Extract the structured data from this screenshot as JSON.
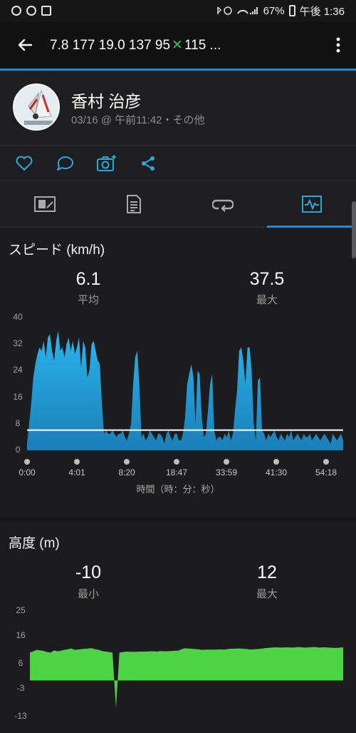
{
  "statusbar": {
    "battery": "67%",
    "time": "午後 1:36"
  },
  "appbar": {
    "title_pre": "7.8  177  19.0  137  95",
    "title_post": "115 ..."
  },
  "profile": {
    "name": "香村 治彦",
    "meta": "03/16 @ 午前11:42・その他"
  },
  "tabs": [
    {
      "icon": "overview-flag-icon"
    },
    {
      "icon": "details-document-icon"
    },
    {
      "icon": "laps-loop-icon"
    },
    {
      "icon": "charts-icon",
      "active": true
    }
  ],
  "speed": {
    "title": "スピード (km/h)",
    "avg_value": "6.1",
    "avg_label": "平均",
    "max_value": "37.5",
    "max_label": "最大",
    "xlabel": "時間（時：分：秒）"
  },
  "altitude": {
    "title": "高度 (m)",
    "min_value": "-10",
    "min_label": "最小",
    "max_value": "12",
    "max_label": "最大"
  },
  "chart_data": [
    {
      "type": "area",
      "title": "スピード (km/h)",
      "xlabel": "時間（時：分：秒）",
      "ylabel": "",
      "ylim": [
        0,
        40
      ],
      "yticks": [
        "40",
        "32",
        "24",
        "16",
        "8",
        "0"
      ],
      "xticks": [
        "0:00",
        "4:01",
        "8:20",
        "18:47",
        "33:59",
        "41:30",
        "54:18"
      ],
      "average_line": 6.1,
      "color": "#29a8e0",
      "values": [
        2,
        8,
        14,
        22,
        26,
        29,
        31,
        30,
        33,
        28,
        34,
        35,
        30,
        27,
        33,
        36,
        30,
        31,
        28,
        32,
        34,
        30,
        33,
        29,
        31,
        34,
        25,
        33,
        31,
        22,
        24,
        32,
        33,
        30,
        27,
        26,
        14,
        5,
        6,
        5,
        5,
        6,
        5,
        4,
        5,
        5,
        6,
        4,
        3,
        5,
        8,
        20,
        28,
        30,
        20,
        4,
        5,
        3,
        4,
        6,
        5,
        4,
        3,
        5,
        5,
        4,
        2,
        5,
        6,
        4,
        3,
        5,
        5,
        3,
        3,
        5,
        10,
        20,
        23,
        26,
        22,
        8,
        24,
        23,
        10,
        4,
        5,
        12,
        20,
        23,
        6,
        3,
        4,
        4,
        3,
        5,
        4,
        6,
        3,
        5,
        12,
        18,
        30,
        31,
        27,
        20,
        31,
        31,
        24,
        8,
        3,
        21,
        22,
        6,
        5,
        3,
        5,
        4,
        5,
        6,
        4,
        3,
        5,
        4,
        3,
        5,
        4,
        6,
        3,
        4,
        5,
        4,
        3,
        5,
        4,
        4,
        5,
        3,
        4,
        5,
        4,
        3,
        4,
        5,
        4,
        3,
        2,
        5,
        4,
        3,
        4,
        5,
        3
      ]
    },
    {
      "type": "area",
      "title": "高度 (m)",
      "ylim": [
        -13,
        25
      ],
      "yticks": [
        "25",
        "16",
        "6",
        "-3",
        "-13"
      ],
      "color": "#4cd444",
      "values": [
        10,
        10.5,
        11,
        10.8,
        10.6,
        10.2,
        10,
        10.8,
        10.5,
        10.7,
        11,
        11.2,
        11.5,
        11,
        11.1,
        11.3,
        11.4,
        11.5,
        11.6,
        11.2,
        11,
        10.6,
        10.4,
        10.2,
        10,
        -10,
        10,
        10.2,
        10.4,
        10.3,
        10.3,
        10.3,
        10.4,
        10.4,
        10.4,
        10.5,
        10.5,
        10.4,
        10.6,
        10.5,
        10.5,
        10.6,
        10.7,
        10.7,
        11.2,
        11.6,
        11.5,
        11.4,
        11.3,
        11.2,
        11,
        11.1,
        11.1,
        11.1,
        11.1,
        11.2,
        11.1,
        11.2,
        11.4,
        11.4,
        11.5,
        11.5,
        11.4,
        11.3,
        11.1,
        11.2,
        11.3,
        11.4,
        11.6,
        11.7,
        11.8,
        11.9,
        11.9,
        11.8,
        11.9,
        11.9,
        11.8,
        11.9,
        12,
        11.9,
        11.8,
        11.9,
        12,
        12,
        11.8,
        11.9,
        11.9,
        11.8,
        11.7,
        11.7,
        11.8,
        11.9
      ]
    }
  ]
}
